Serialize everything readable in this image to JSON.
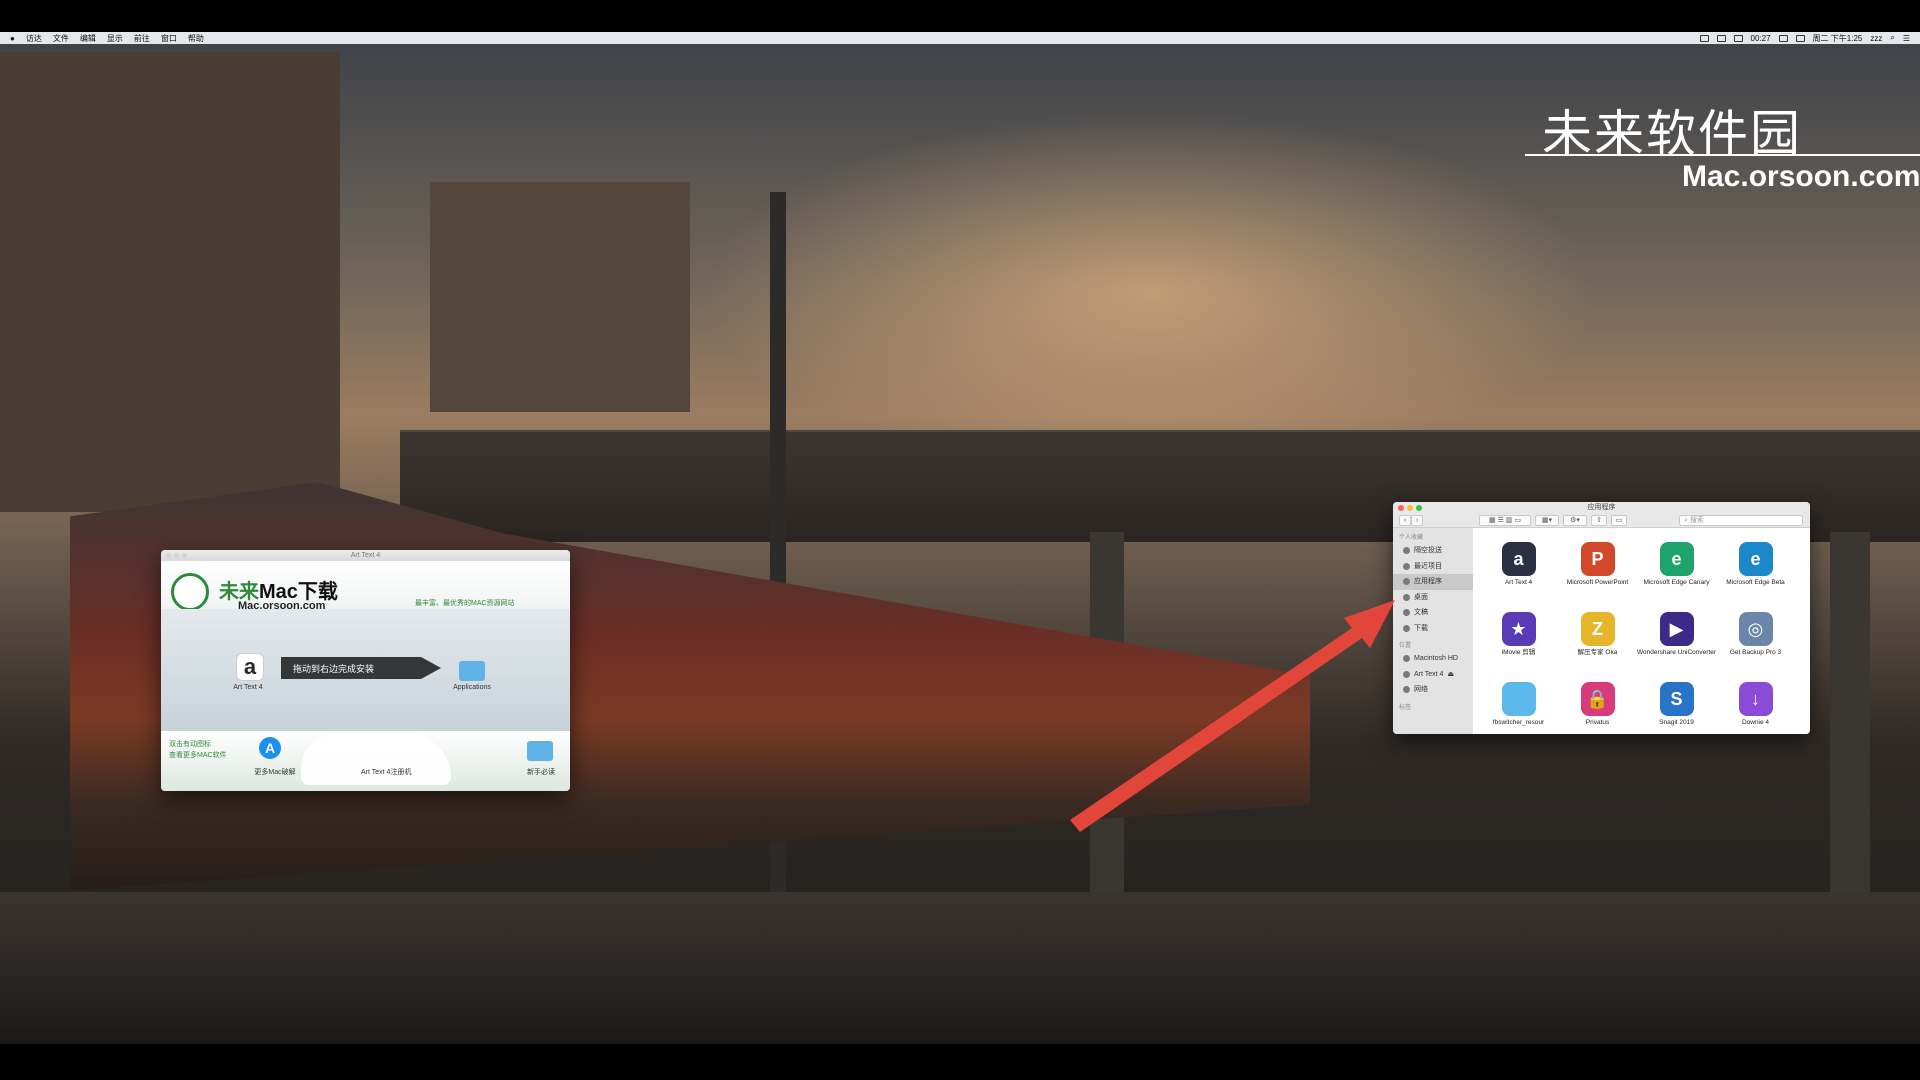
{
  "menubar": {
    "app_menu": "访达",
    "items": [
      "文件",
      "编辑",
      "显示",
      "前往",
      "窗口",
      "帮助"
    ],
    "clock_status": "00:27",
    "datetime": "周二 下午1:25",
    "user": "zzz"
  },
  "watermark": {
    "title": "未来软件园",
    "url": "Mac.orsoon.com"
  },
  "installer": {
    "window_title": "Art Text 4",
    "brand_name_green": "未来",
    "brand_name_dark": "Mac下载",
    "brand_url": "Mac.orsoon.com",
    "slogan": "最丰富、最优秀的MAC资源网站",
    "app_label": "Art Text 4",
    "drag_instruction": "拖动到右边完成安装",
    "applications_label": "Applications",
    "bottom_left_line1": "双击有动图标",
    "bottom_left_line2": "查看更多MAC软件",
    "more_mac_label": "更多Mac破解",
    "guide_label": "Art Text 4注册机",
    "newbie_label": "新手必读"
  },
  "finder": {
    "window_title": "应用程序",
    "search_placeholder": "搜索",
    "sidebar_headers": {
      "personal": "个人收藏",
      "locations": "位置",
      "tags": "标签"
    },
    "favorites": [
      "隔空投送",
      "最近项目",
      "应用程序",
      "桌面",
      "文稿",
      "下载"
    ],
    "locations": [
      "Macintosh HD",
      "Art Text 4",
      "网络"
    ],
    "apps": [
      {
        "name": "Art Text 4",
        "glyph": "a",
        "color": "#2d2f45"
      },
      {
        "name": "Microsoft PowerPoint",
        "glyph": "P",
        "color": "#d2492a"
      },
      {
        "name": "Microsoft Edge Canary",
        "glyph": "e",
        "color": "#1fa36d"
      },
      {
        "name": "Microsoft Edge Beta",
        "glyph": "e",
        "color": "#1a88c9"
      },
      {
        "name": "iMovie 剪辑",
        "glyph": "★",
        "color": "#5b3ab8"
      },
      {
        "name": "解压专家 Oka",
        "glyph": "Z",
        "color": "#e6b52a"
      },
      {
        "name": "Wondershare UniConverter",
        "glyph": "▶",
        "color": "#3d2a88"
      },
      {
        "name": "Get Backup Pro 3",
        "glyph": "◎",
        "color": "#6b86a8"
      },
      {
        "name": "fbswitcher_resour",
        "glyph": "",
        "color": "#5cb8ea"
      },
      {
        "name": "Privatus",
        "glyph": "🔒",
        "color": "#d83a7c"
      },
      {
        "name": "Snagit 2019",
        "glyph": "S",
        "color": "#2a74c8"
      },
      {
        "name": "Downie 4",
        "glyph": "↓",
        "color": "#8a4bd6"
      }
    ]
  },
  "colors": {
    "brand_green": "#2c8a3a",
    "arrow_red": "#e2463b"
  }
}
